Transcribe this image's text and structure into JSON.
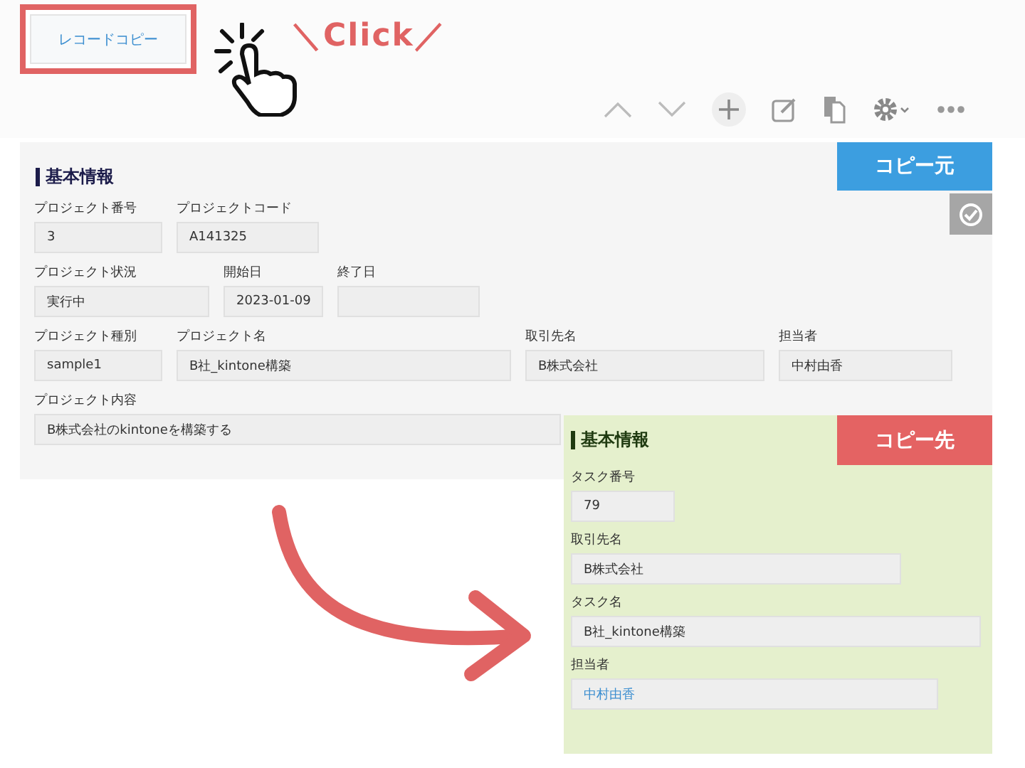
{
  "copy_button": {
    "label": "レコードコピー"
  },
  "click_note": {
    "text": "＼Click／"
  },
  "source": {
    "tag": "コピー元",
    "section": "基本情報",
    "rows": [
      [
        {
          "label": "プロジェクト番号",
          "value": "3"
        },
        {
          "label": "プロジェクトコード",
          "value": "A141325"
        }
      ],
      [
        {
          "label": "プロジェクト状況",
          "value": "実行中"
        },
        {
          "label": "開始日",
          "value": "2023-01-09"
        },
        {
          "label": "終了日"
        }
      ],
      [
        {
          "label": "プロジェクト種別",
          "value": "sample1"
        },
        {
          "label": "プロジェクト名",
          "value": "B社_kintone構築"
        },
        {
          "label": "取引先名",
          "value": "B株式会社"
        },
        {
          "label": "担当者",
          "value": "中村由香"
        }
      ],
      [
        {
          "label": "プロジェクト内容",
          "value": "B株式会社のkintoneを構築する"
        }
      ]
    ]
  },
  "dest": {
    "tag": "コピー先",
    "section": "基本情報",
    "fields": [
      {
        "label": "タスク番号",
        "value": "79",
        "kind": "text"
      },
      {
        "label": "取引先名",
        "value": "B株式会社",
        "kind": "text"
      },
      {
        "label": "タスク名",
        "value": "B社_kintone構築",
        "kind": "text"
      },
      {
        "label": "担当者",
        "value": "中村由香",
        "kind": "user"
      }
    ]
  }
}
